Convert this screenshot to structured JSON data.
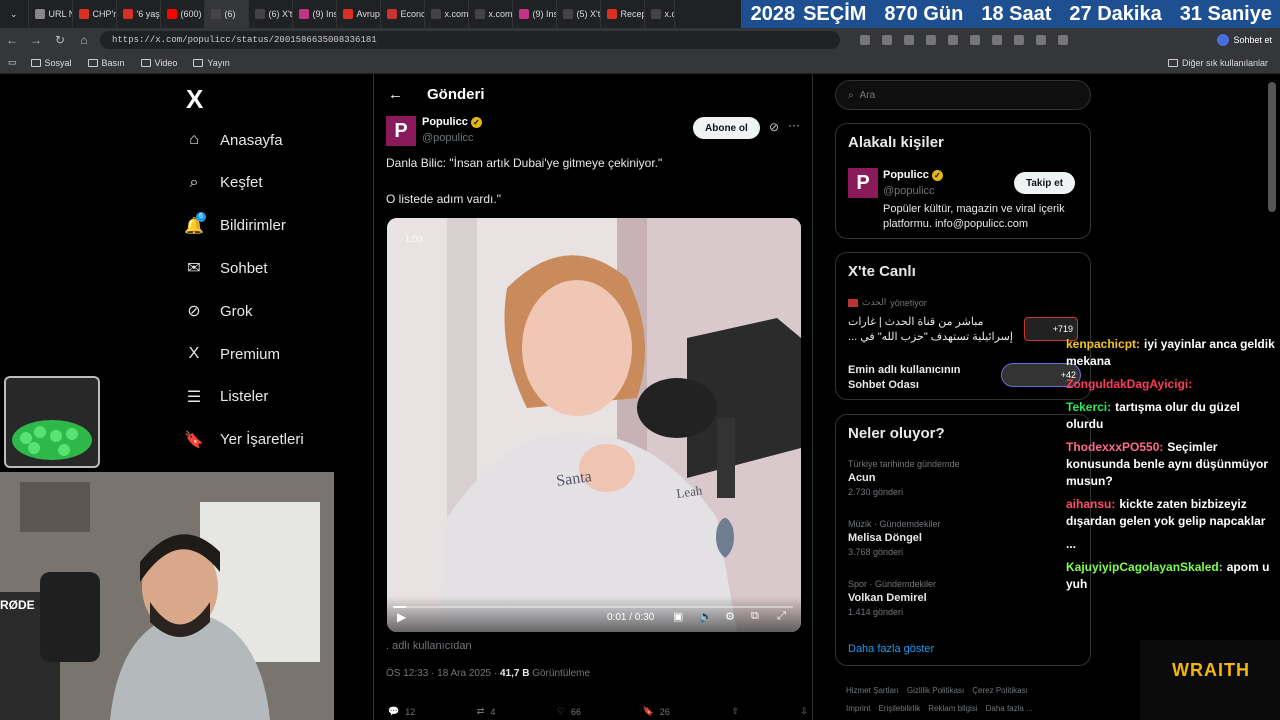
{
  "browser": {
    "tabs": [
      "URL N",
      "CHP'ni",
      "'6 yaşı",
      "(600) E",
      "(6)",
      "(6) X'te",
      "(9) Inst",
      "Avrupa",
      "Econo",
      "x.com/",
      "x.com/",
      "(9) Inst",
      "(5) X'te",
      "Recep",
      "x.c"
    ],
    "url": "https://x.com/populicc/status/2001586635008336181",
    "chat_button": "Sohbet et",
    "bookmarks": [
      "Sosyal",
      "Basın",
      "Video",
      "Yayın"
    ],
    "other_bookmarks": "Diğer sık kullanılanlar"
  },
  "election_banner": {
    "year": "2028",
    "label": "SEÇİM",
    "days": "870 Gün",
    "hours": "18 Saat",
    "minutes": "27 Dakika",
    "seconds": "31 Saniye"
  },
  "nav": {
    "logo": "X",
    "items": [
      {
        "label": "Anasayfa",
        "icon": "home-icon"
      },
      {
        "label": "Keşfet",
        "icon": "search-icon"
      },
      {
        "label": "Bildirimler",
        "icon": "bell-icon",
        "badge": "6"
      },
      {
        "label": "Sohbet",
        "icon": "mail-icon"
      },
      {
        "label": "Grok",
        "icon": "grok-icon"
      },
      {
        "label": "Premium",
        "icon": "x-icon"
      },
      {
        "label": "Listeler",
        "icon": "list-icon"
      },
      {
        "label": "Yer İşaretleri",
        "icon": "bookmark-icon"
      }
    ]
  },
  "post": {
    "header_title": "Gönderi",
    "author_name": "Populicc",
    "author_handle": "@populicc",
    "subscribe": "Abone ol",
    "text_line1": "Danla Bilic: \"İnsan artık Dubai'ye gitmeye çekiniyor.\"",
    "text_line2": "O listede adım vardı.\"",
    "video": {
      "duration_badge": "1:00",
      "time": "0:01 / 0:30",
      "progress": 0.033
    },
    "note": ". adlı kullanıcıdan",
    "time": "ÖS 12:33 · 18 Ara 2025 ·",
    "views_value": "41,7 B",
    "views_label": "Görüntüleme",
    "replies": "12",
    "reposts": "4",
    "likes": "66",
    "bookmarks": "26"
  },
  "sidebar": {
    "search_placeholder": "Ara",
    "related_title": "Alakalı kişiler",
    "related": {
      "name": "Populicc",
      "handle": "@populicc",
      "follow": "Takip et",
      "bio": "Popüler kültür, magazin ve viral içerik platformu. info@populicc.com"
    },
    "live_title": "X'te Canlı",
    "live": [
      {
        "host": "الحدث",
        "role": "yönetiyor",
        "title": "مباشر من قناة الحدث | غارات إسرائيلية تستهدف \"حزب الله\" في ...",
        "count": "+719"
      },
      {
        "title": "Emin adlı kullanıcının Sohbet Odası",
        "count": "+42"
      }
    ],
    "trends_title": "Neler oluyor?",
    "trends": [
      {
        "category": "Türkiye tarihinde gündemde",
        "name": "Acun",
        "count": "2.730 gönderi"
      },
      {
        "category": "Müzik · Gündemdekiler",
        "name": "Melisa Döngel",
        "count": "3.768 gönderi"
      },
      {
        "category": "Spor · Gündemdekiler",
        "name": "Volkan Demirel",
        "count": "1.414 gönderi"
      }
    ],
    "show_more": "Daha fazla göster",
    "footer": [
      "Hizmet Şartları",
      "Gizlilik Politikası",
      "Çerez Politikası",
      "Imprint",
      "Erişilebilirlik",
      "Reklam bilgisi",
      "Daha fazla ..."
    ]
  },
  "stream_chat": [
    {
      "user": "kenpachicpt:",
      "text": "iyi yayinlar anca geldik mekana",
      "color": "#f5c518"
    },
    {
      "user": "ZonguldakDagAyicigi:",
      "text": "",
      "color": "#ff3b5c"
    },
    {
      "user": "Tekerci:",
      "text": "tartışma olur du güzel olurdu",
      "color": "#2ee85c"
    },
    {
      "user": "ThodexxxPO550:",
      "text": "Seçimler konusunda benle aynı düşünmüyor musun?",
      "color": "#ff6b8a"
    },
    {
      "user": "aihansu:",
      "text": "kickte zaten bizbizeyiz dışardan gelen yok gelip napcaklar",
      "color": "#ff4d6d"
    },
    {
      "user": "...",
      "text": "",
      "color": "#ffffff"
    },
    {
      "user": "KajuyiyipCagolayanSkaled:",
      "text": "apom u yuh",
      "color": "#7cff4d"
    }
  ],
  "overlays": {
    "sponsor": "WRAITH",
    "mic_brand": "RØDE"
  }
}
